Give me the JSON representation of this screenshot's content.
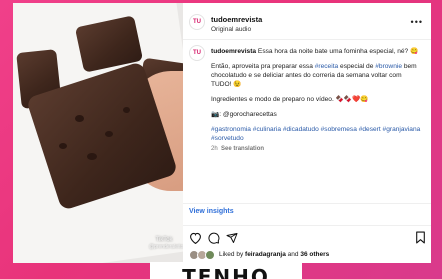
{
  "colors": {
    "background": "#e8337a",
    "hashtag": "#2a5aa8",
    "link": "#2f6fd8",
    "avatar_text": "#d6226e"
  },
  "media": {
    "watermark_app": "TikTok",
    "watermark_user": "@prenderaleitor"
  },
  "header": {
    "avatar_text": "TU",
    "username": "tudoemrevista",
    "subtitle": "Original audio",
    "more_icon": "more-horizontal-icon"
  },
  "caption": {
    "avatar_text": "TU",
    "username": "tudoemrevista",
    "line1": "Essa hora da noite bate uma fominha especial, né? 😋",
    "p2_a": "Então, aproveita pra preparar essa ",
    "p2_tag1": "#receita",
    "p2_b": " especial de ",
    "p2_tag2": "#brownie",
    "p2_c": " bem chocolatudo e se deliciar antes do correria da semana voltar com TUDO! 😉",
    "p3": "Ingredientes e modo de preparo no vídeo. 🍫🍫❤️😋",
    "p4": "📷: @gorocharecettas",
    "hashtags": "#gastronomia #culinaria #dicadatudo #sobremesa #desert #granjaviana #sorvetudo",
    "time": "2h",
    "see_translation": "See translation"
  },
  "view_insights": "View insights",
  "actions": {
    "like_icon": "heart-icon",
    "comment_icon": "comment-icon",
    "share_icon": "send-icon",
    "save_icon": "bookmark-icon"
  },
  "likes": {
    "prefix": "Liked by ",
    "user": "feiradagranja",
    "middle": " and ",
    "others": "36 others"
  },
  "overlay_text": "TENHO"
}
